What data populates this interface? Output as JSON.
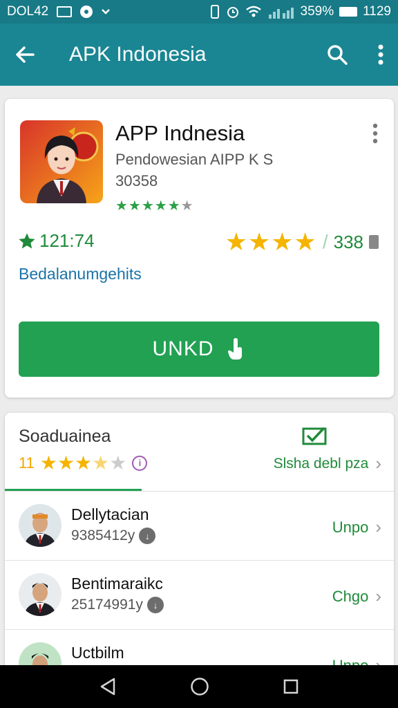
{
  "status_bar": {
    "left_text": "DOL42",
    "right_text": "359%",
    "time": "1129"
  },
  "app_bar": {
    "title": "APK Indonesia"
  },
  "app": {
    "name": "APP Indnesia",
    "developer": "Pendowesian AIPP K S",
    "size": "30358",
    "star_rating": 4.5
  },
  "ratings": {
    "left_value": "121:74",
    "right_count": "338",
    "stars_shown": 4
  },
  "link_text": "Bedalanumgehits",
  "install_label": "UNKD",
  "reviews": {
    "title": "Soaduainea",
    "rating_number": "11",
    "stars_shown": 3.5,
    "link_text": "Slsha debl pza",
    "items": [
      {
        "name": "Dellytacian",
        "sub": "9385412y",
        "action": "Unpo"
      },
      {
        "name": "Bentimaraikc",
        "sub": "25174991y",
        "action": "Chgo"
      },
      {
        "name": "Uctbilm",
        "sub": "",
        "action": "Unpo"
      }
    ]
  },
  "colors": {
    "primary": "#1a8693",
    "accent": "#22a153",
    "star": "#f5b400"
  }
}
